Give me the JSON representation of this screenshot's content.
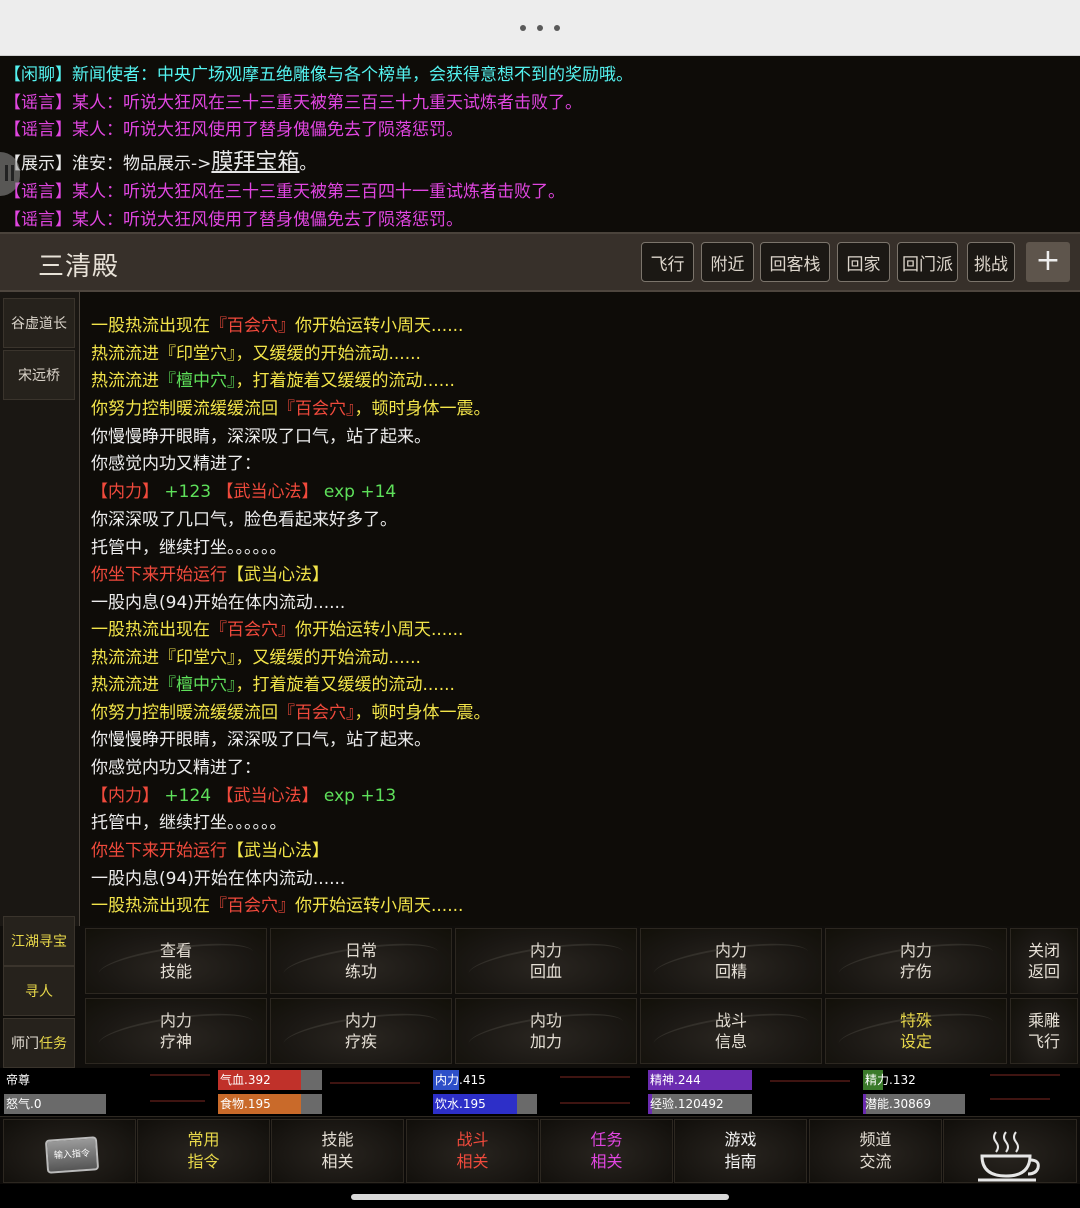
{
  "chat": {
    "lines": [
      {
        "tag": "【闲聊】",
        "text": "新闻使者：中央广场观摩五绝雕像与各个榜单，会获得意想不到的奖励哦。"
      },
      {
        "tag": "【谣言】",
        "text": "某人：听说大狂风在三十三重天被第三百三十九重天试炼者击败了。"
      },
      {
        "tag": "【谣言】",
        "text": "某人：听说大狂风使用了替身傀儡免去了陨落惩罚。"
      },
      {
        "tag": "【展示】",
        "text": "淮安：物品展示->",
        "link": "膜拜宝箱",
        "end": "。"
      },
      {
        "tag": "【谣言】",
        "text": "某人：听说大狂风在三十三重天被第三百四十一重试炼者击败了。"
      },
      {
        "tag": "【谣言】",
        "text": "某人：听说大狂风使用了替身傀儡免去了陨落惩罚。"
      }
    ]
  },
  "header": {
    "location": "三清殿",
    "buttons": [
      "飞行",
      "附近",
      "回客栈",
      "回家",
      "回门派",
      "挑战"
    ],
    "plus": "+"
  },
  "npcs": [
    "谷虚道长",
    "宋远桥"
  ],
  "log": {
    "l01a": "一股热流出现在",
    "l01b": "『百会穴』",
    "l01c": "你开始运转小周天......",
    "l02": "热流流进『印堂穴』，又缓缓的开始流动......",
    "l03a": "热流流进",
    "l03b": "『檀中穴』",
    "l03c": "，打着旋着又缓缓的流动......",
    "l04a": "你努力控制暖流缓缓流回",
    "l04b": "『百会穴』",
    "l04c": "，顿时身体一震。",
    "l05": "你慢慢睁开眼睛，深深吸了口气，站了起来。",
    "l06": "你感觉内功又精进了：",
    "l07a": "【内力】",
    "l07b": "+123",
    "l07c": "【武当心法】",
    "l07d": "exp +14",
    "l08": "你深深吸了几口气，脸色看起来好多了。",
    "l09": "托管中，继续打坐。。。。。。",
    "l10a": "你坐下来开始运行",
    "l10b": "【武当心法】",
    "l11": "一股内息(94)开始在体内流动......",
    "l12a": "一股热流出现在",
    "l12b": "『百会穴』",
    "l12c": "你开始运转小周天......",
    "l13": "热流流进『印堂穴』，又缓缓的开始流动......",
    "l14a": "热流流进",
    "l14b": "『檀中穴』",
    "l14c": "，打着旋着又缓缓的流动......",
    "l15a": "你努力控制暖流缓缓流回",
    "l15b": "『百会穴』",
    "l15c": "，顿时身体一震。",
    "l16": "你慢慢睁开眼睛，深深吸了口气，站了起来。",
    "l17": "你感觉内功又精进了：",
    "l18a": "【内力】",
    "l18b": "+124",
    "l18c": "【武当心法】",
    "l18d": "exp +13",
    "l19": "托管中，继续打坐。。。。。。",
    "l20a": "你坐下来开始运行",
    "l20b": "【武当心法】",
    "l21": "一股内息(94)开始在体内流动......",
    "l22a": "一股热流出现在",
    "l22b": "『百会穴』",
    "l22c": "你开始运转小周天......"
  },
  "side": {
    "treasure": "江湖寻宝",
    "seek": "寻人",
    "sect_a": "师门",
    "sect_b": "任务"
  },
  "actions": {
    "row1": [
      [
        "查看",
        "技能"
      ],
      [
        "日常",
        "练功"
      ],
      [
        "内力",
        "回血"
      ],
      [
        "内力",
        "回精"
      ],
      [
        "内力",
        "疗伤"
      ],
      [
        "关闭",
        "返回"
      ]
    ],
    "row2": [
      [
        "内力",
        "疗神"
      ],
      [
        "内力",
        "疗疾"
      ],
      [
        "内功",
        "加力"
      ],
      [
        "战斗",
        "信息"
      ],
      [
        "特殊",
        "设定"
      ],
      [
        "乘雕",
        "飞行"
      ]
    ]
  },
  "stats": {
    "title": "帝尊",
    "rage": "怒气.0",
    "hp": "气血.392",
    "food": "食物.195",
    "neili": "内力.415",
    "water": "饮水.195",
    "jingshen": "精神.244",
    "exp": "经验.120492",
    "jingli": "精力.132",
    "potential": "潜能.30869"
  },
  "nav": {
    "input_icon_text": "输入指令",
    "items": [
      [
        "常用",
        "指令"
      ],
      [
        "技能",
        "相关"
      ],
      [
        "战斗",
        "相关"
      ],
      [
        "任务",
        "相关"
      ],
      [
        "游戏",
        "指南"
      ],
      [
        "频道",
        "交流"
      ]
    ]
  },
  "colors": {
    "chat_cyan": "#54f2f0",
    "chat_magenta": "#e046e0",
    "log_yellow": "#f2e44a",
    "log_red": "#f04a3c",
    "log_green": "#5ee05a",
    "hp_bar": "#c0312a",
    "food_bar": "#c96a2a",
    "neili_bar": "#2d4fc8",
    "jingshen_bar": "#6b2bb0",
    "exp_bar": "#6b2bb0",
    "jingli_bar": "#3a7a2a",
    "potential_bar": "#6b2bb0"
  }
}
